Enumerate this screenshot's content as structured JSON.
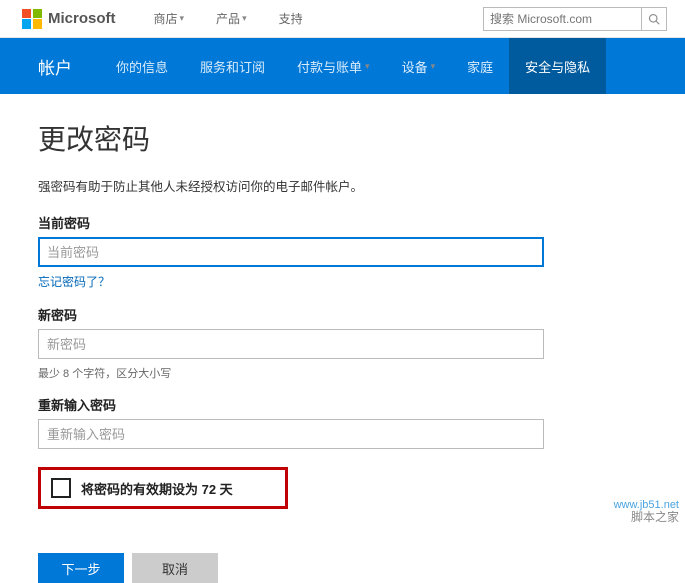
{
  "header": {
    "brand": "Microsoft",
    "nav": [
      {
        "label": "商店",
        "has_caret": true
      },
      {
        "label": "产品",
        "has_caret": true
      },
      {
        "label": "支持",
        "has_caret": false
      }
    ],
    "search_placeholder": "搜索 Microsoft.com"
  },
  "blue_nav": {
    "brand": "帐户",
    "items": [
      {
        "label": "你的信息",
        "has_caret": false,
        "active": false
      },
      {
        "label": "服务和订阅",
        "has_caret": false,
        "active": false
      },
      {
        "label": "付款与账单",
        "has_caret": true,
        "active": false
      },
      {
        "label": "设备",
        "has_caret": true,
        "active": false
      },
      {
        "label": "家庭",
        "has_caret": false,
        "active": false
      },
      {
        "label": "安全与隐私",
        "has_caret": false,
        "active": true
      }
    ]
  },
  "page": {
    "title": "更改密码",
    "description": "强密码有助于防止其他人未经授权访问你的电子邮件帐户。",
    "current_pwd_label": "当前密码",
    "current_pwd_placeholder": "当前密码",
    "forgot_link": "忘记密码了？",
    "new_pwd_label": "新密码",
    "new_pwd_placeholder": "新密码",
    "new_pwd_hint": "最少 8 个字符，区分大小写",
    "confirm_pwd_label": "重新输入密码",
    "confirm_pwd_placeholder": "重新输入密码",
    "expire_checkbox_label": "将密码的有效期设为 72 天",
    "next_button": "下一步",
    "cancel_button": "取消"
  },
  "watermark": {
    "url": "www.jb51.net",
    "name": "脚本之家"
  }
}
